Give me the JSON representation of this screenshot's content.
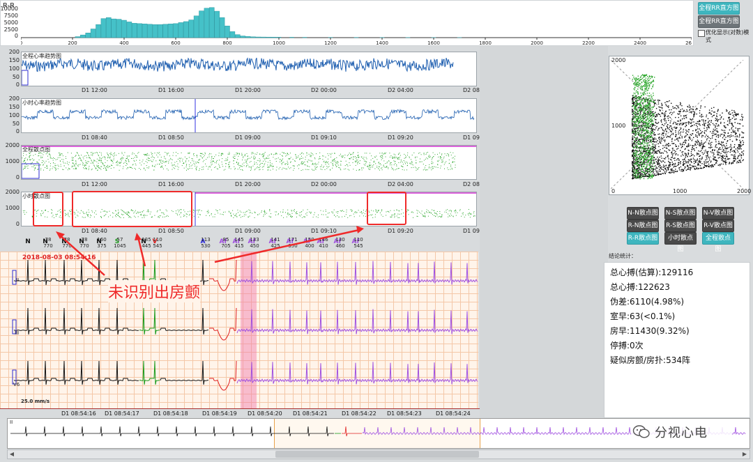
{
  "rr_hist": {
    "title": "R-R",
    "y_ticks": [
      "10000",
      "7500",
      "5000",
      "2500",
      "0"
    ],
    "x_ticks": [
      "0",
      "200",
      "400",
      "600",
      "800",
      "1000",
      "1200",
      "1400",
      "1600",
      "1800",
      "2000",
      "2200",
      "2400",
      "2600"
    ],
    "btn_full": "全程RR直方图",
    "btn_full2": "全程RR直方图",
    "checkbox_label": "优化显示(对数)模式"
  },
  "chart_data": [
    {
      "type": "bar",
      "title": "R-R",
      "xlabel": "",
      "ylabel": "",
      "xlim": [
        0,
        2600
      ],
      "ylim": [
        0,
        10000
      ],
      "x": [
        220,
        240,
        260,
        280,
        300,
        320,
        340,
        360,
        380,
        400,
        420,
        440,
        460,
        480,
        500,
        520,
        540,
        560,
        580,
        600,
        620,
        640,
        660,
        680,
        700,
        720,
        740,
        760,
        780,
        800,
        820,
        840,
        860,
        880,
        900,
        920,
        940,
        960,
        980,
        1000,
        1050,
        1100,
        1200,
        1300,
        1400,
        1500,
        1600,
        1700
      ],
      "values": [
        300,
        800,
        1400,
        2600,
        3900,
        5700,
        6000,
        5600,
        5500,
        5200,
        4700,
        4300,
        4200,
        4100,
        4000,
        3900,
        3900,
        4000,
        4100,
        4200,
        4500,
        4800,
        5300,
        6500,
        8000,
        8800,
        9000,
        7900,
        6000,
        3500,
        1800,
        900,
        500,
        350,
        250,
        200,
        180,
        160,
        150,
        140,
        120,
        100,
        80,
        70,
        60,
        50,
        40,
        30
      ],
      "grid": false
    }
  ],
  "hr_full": {
    "title": "全程心率趋势图",
    "y_ticks": [
      "200",
      "150",
      "100",
      "50",
      "0"
    ],
    "x_ticks": [
      "D1 12:00",
      "D1 16:00",
      "D1 20:00",
      "D2 00:00",
      "D2 04:00",
      "D2 08"
    ]
  },
  "hr_hour": {
    "title": "小时心率趋势图",
    "y_ticks": [
      "200",
      "150",
      "100",
      "50",
      "0"
    ],
    "x_ticks": [
      "D1 08:40",
      "D1 08:50",
      "D1 09:00",
      "D1 09:10",
      "D1 09:20",
      "D1 09"
    ]
  },
  "sc_full": {
    "title": "全程散点图",
    "y_ticks": [
      "2000",
      "1000",
      "0"
    ],
    "x_ticks": [
      "D1 12:00",
      "D1 16:00",
      "D1 20:00",
      "D2 00:00",
      "D2 04:00",
      "D2 08"
    ]
  },
  "sc_hour": {
    "title": "小时散点图",
    "y_ticks": [
      "2000",
      "1000",
      "0"
    ],
    "x_ticks": [
      "D1 08:40",
      "D1 08:50",
      "D1 09:00",
      "D1 09:10",
      "D1 09:20",
      "D1 09"
    ]
  },
  "lorenz": {
    "y_ticks": [
      "2000",
      "1000",
      "0"
    ],
    "x_ticks": [
      "0",
      "1000",
      "2000"
    ]
  },
  "lorenz_buttons": [
    {
      "label": "N-N散点图",
      "style": "dark"
    },
    {
      "label": "N-S散点图",
      "style": "dark"
    },
    {
      "label": "N-V散点图",
      "style": "dark"
    },
    {
      "label": "R-N散点图",
      "style": "dark"
    },
    {
      "label": "R-S散点图",
      "style": "dark"
    },
    {
      "label": "R-V散点图",
      "style": "dark"
    },
    {
      "label": "R-R散点图",
      "style": "teal"
    },
    {
      "label": "小时散点图",
      "style": "dark"
    },
    {
      "label": "全程散点图",
      "style": "teal"
    }
  ],
  "summary": {
    "header": "结论统计：",
    "lines": [
      "总心搏(估算):129116",
      "总心搏:122623",
      "伪差:6110(4.98%)",
      "室早:63(<0.1%)",
      "房早:11430(9.32%)",
      "停搏:0次",
      "疑似房颤/房扑:534阵"
    ]
  },
  "ecg": {
    "timestamp": "2018-08-03 08:54:16",
    "speed": "25.0 mm/s",
    "leads": [
      "II",
      "III",
      "V6"
    ],
    "beats": [
      {
        "type": "N",
        "rr": "",
        "color": "#111"
      },
      {
        "type": "N",
        "rr": "78\n770",
        "color": "#111"
      },
      {
        "type": "N",
        "rr": "78\n770",
        "color": "#111"
      },
      {
        "type": "N",
        "rr": "78\n770",
        "color": "#111"
      },
      {
        "type": "N",
        "rr": "160\n375",
        "color": "#111"
      },
      {
        "type": "S",
        "rr": "57\n1045",
        "color": "#1a9a1a"
      },
      {
        "type": "N",
        "rr": "135\n445",
        "color": "#111"
      },
      {
        "type": "V",
        "rr": "110\n545",
        "color": "#e02020"
      },
      {
        "type": "A",
        "rr": "113\n530",
        "color": "#3030e0"
      },
      {
        "type": "Af",
        "rr": "85\n705",
        "color": "#a050e0"
      },
      {
        "type": "Af",
        "rr": "145\n415",
        "color": "#a050e0"
      },
      {
        "type": "Af",
        "rr": "133\n450",
        "color": "#a050e0"
      },
      {
        "type": "Af",
        "rr": "141\n425",
        "color": "#a050e0"
      },
      {
        "type": "Af",
        "rr": "171\n350",
        "color": "#a050e0"
      },
      {
        "type": "Af",
        "rr": "150\n400",
        "color": "#a050e0"
      },
      {
        "type": "Af",
        "rr": "146\n410",
        "color": "#a050e0"
      },
      {
        "type": "Af",
        "rr": "130\n460",
        "color": "#a050e0"
      },
      {
        "type": "Af",
        "rr": "110\n545",
        "color": "#a050e0"
      }
    ],
    "time_marks": [
      {
        "d": "D1",
        "t": "08:54:16"
      },
      {
        "d": "D1",
        "t": "08:54:17"
      },
      {
        "d": "D1",
        "t": "08:54:18"
      },
      {
        "d": "D1",
        "t": "08:54:19"
      },
      {
        "d": "D1",
        "t": "08:54:20"
      },
      {
        "d": "D1",
        "t": "08:54:21"
      },
      {
        "d": "D1",
        "t": "08:54:22"
      },
      {
        "d": "D1",
        "t": "08:54:23"
      },
      {
        "d": "D1",
        "t": "08:54:24"
      }
    ]
  },
  "annotation": {
    "text": "未识别出房颤"
  },
  "overview": {
    "lead": "II"
  },
  "watermark": {
    "text": "分视心电"
  },
  "colors": {
    "teal": "#3fb6bf",
    "hr_blue": "#1f5fb0",
    "scatter_green": "#2fa82f",
    "annotation_red": "#ef2a2a",
    "af_purple": "#a050e0"
  }
}
